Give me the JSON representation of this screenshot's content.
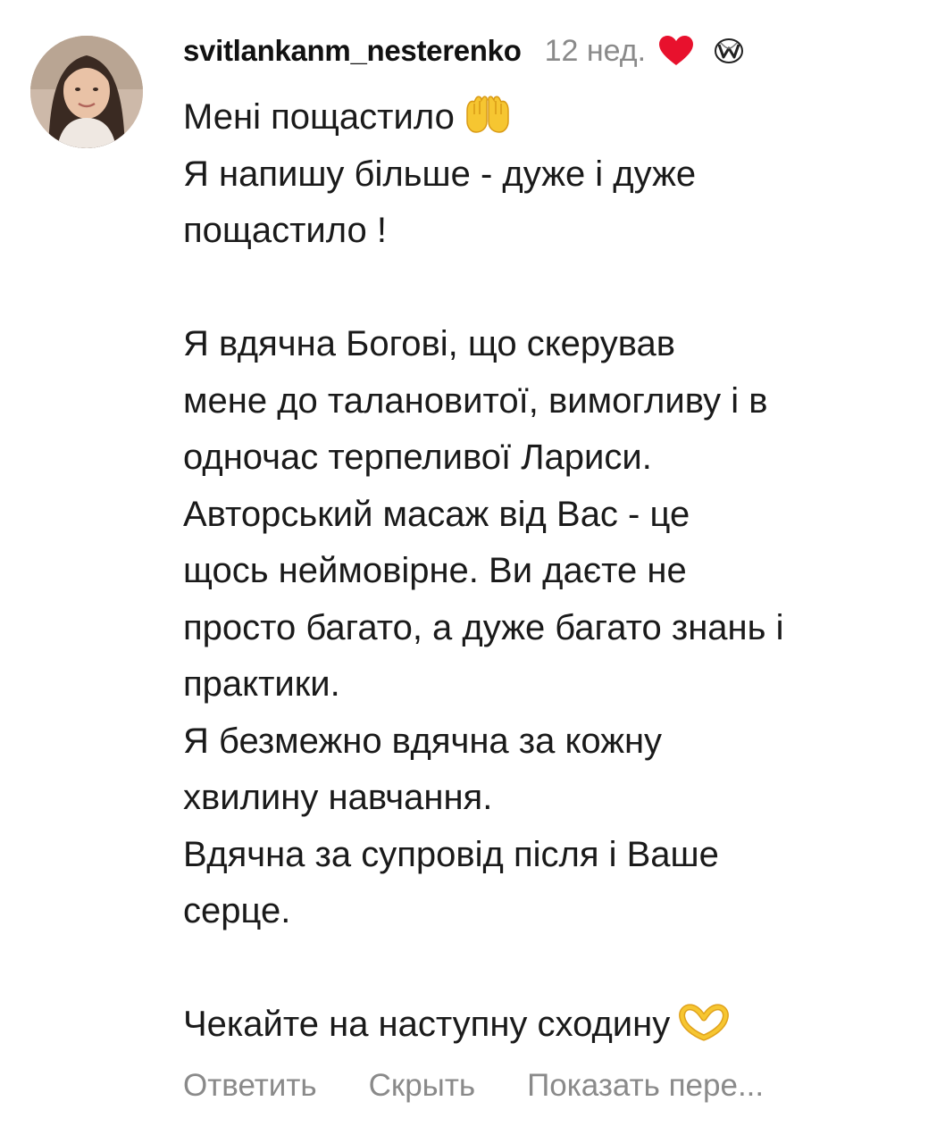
{
  "comment": {
    "username": "svitlankanm_nesterenko",
    "time": "12 нед.",
    "icons": {
      "liked": "heart-icon",
      "creator_badge": "badge-icon",
      "praying_hands": "palms-up-together-icon",
      "heart_hands": "heart-hands-icon"
    },
    "colors": {
      "heart": "#e8112d",
      "muted_text": "#8a8a8a",
      "body_text": "#1a1a1a",
      "emoji_yellow": "#f6c631"
    },
    "lines": [
      "Мені пощастило",
      "Я напишу більше - дуже і дуже",
      "пощастило !",
      "",
      "Я вдячна Богові, що скерував",
      "мене до талановитої, вимогливу і в",
      "одночас терпеливої Лариси.",
      "Авторський масаж від Вас - це",
      "щось неймовірне. Ви даєте не",
      "просто багато, а дуже багато знань і",
      "практики.",
      "Я безмежно вдячна за кожну",
      "хвилину навчання.",
      "Вдячна за супровід після і Ваше",
      "серце.",
      "",
      "Чекайте на наступну сходину"
    ],
    "actions": {
      "reply": "Ответить",
      "hide": "Скрыть",
      "translate": "Показать пере..."
    }
  }
}
